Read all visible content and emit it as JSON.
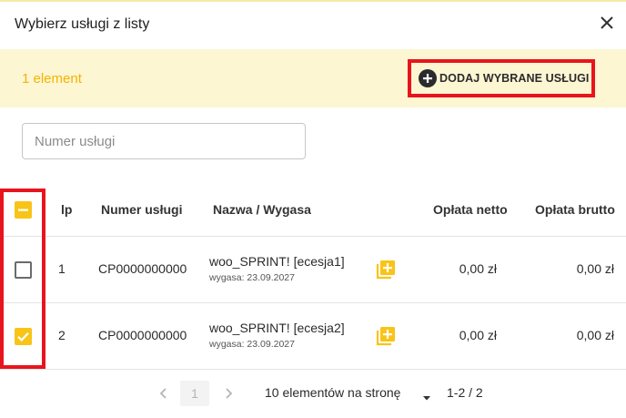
{
  "dialog": {
    "title": "Wybierz usługi z listy"
  },
  "banner": {
    "count_label": "1 element",
    "add_button_label": "DODAJ WYBRANE USŁUGI"
  },
  "search": {
    "placeholder": "Numer usługi",
    "value": ""
  },
  "table": {
    "headers": {
      "lp": "lp",
      "number": "Numer usługi",
      "name": "Nazwa / Wygasa",
      "net": "Opłata netto",
      "gross": "Opłata brutto"
    },
    "header_checkbox_state": "indeterminate",
    "rows": [
      {
        "checked": false,
        "lp": "1",
        "number": "CP0000000000",
        "name": "woo_SPRINT! [ecesja1]",
        "expires": "wygasa: 23.09.2027",
        "net": "0,00 zł",
        "gross": "0,00 zł"
      },
      {
        "checked": true,
        "lp": "2",
        "number": "CP0000000000",
        "name": "woo_SPRINT! [ecesja2]",
        "expires": "wygasa: 23.09.2027",
        "net": "0,00 zł",
        "gross": "0,00 zł"
      }
    ]
  },
  "pagination": {
    "current_page": "1",
    "per_page_label": "10 elementów na stronę",
    "range_label": "1-2 / 2"
  },
  "icons": {
    "close": "close-icon",
    "add": "plus-circle-icon",
    "copy": "add-to-library-icon",
    "prev": "chevron-left-icon",
    "next": "chevron-right-icon",
    "dropdown": "caret-down-icon"
  },
  "colors": {
    "accent_yellow": "#f8c417",
    "banner_background": "#fdf6d3",
    "count_text": "#f2b400",
    "highlight_red": "#e8141d"
  }
}
